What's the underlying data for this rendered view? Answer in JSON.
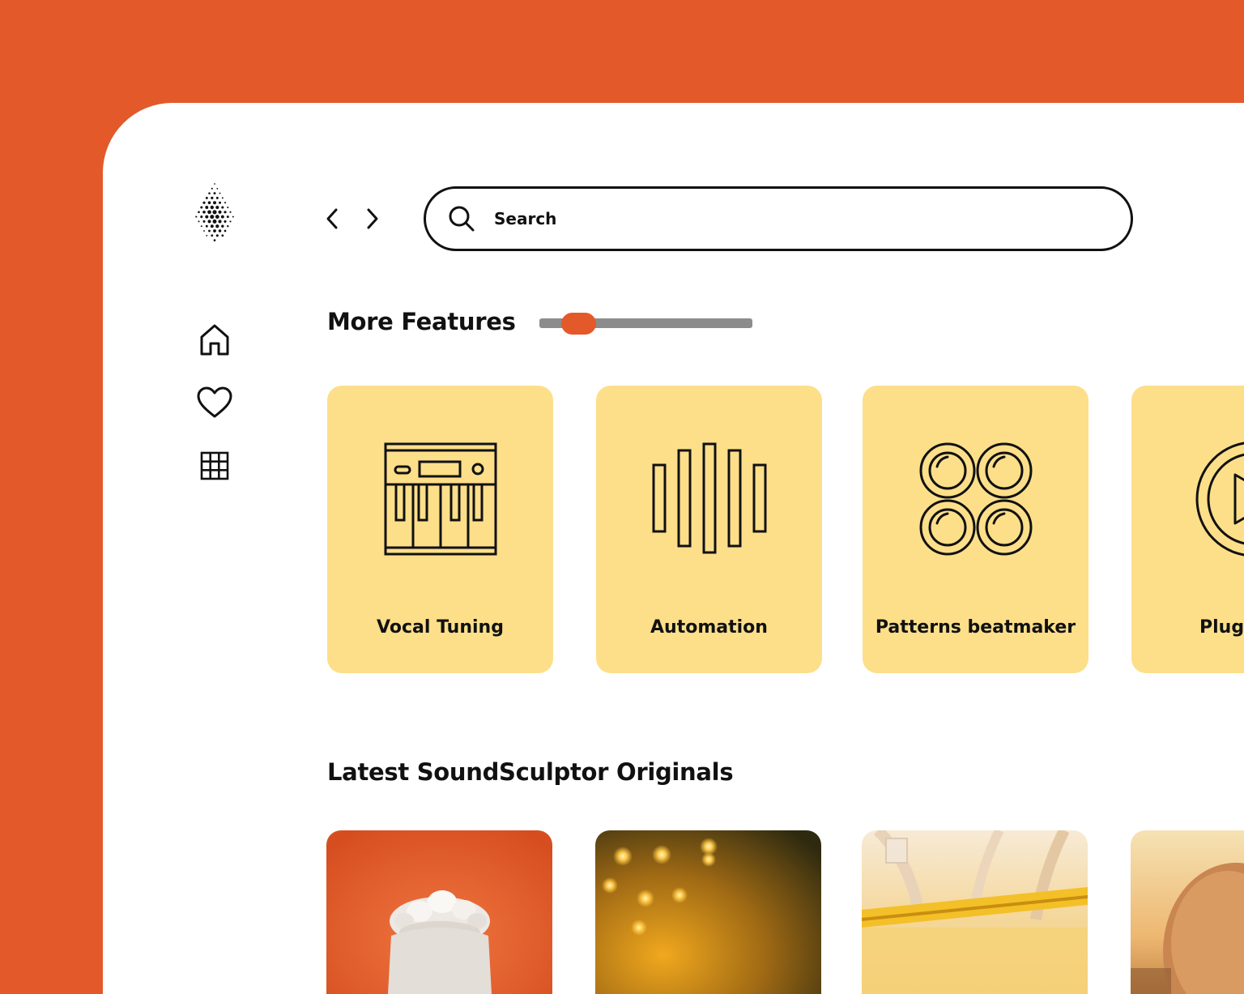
{
  "colors": {
    "accent": "#E4592A",
    "card_bg": "#FDDF8A",
    "slider_track": "#8C8C8C",
    "text": "#111111",
    "background": "#FFFFFF"
  },
  "logo": {
    "icon": "dotted-diamond-logo"
  },
  "sidebar": {
    "items": [
      {
        "icon": "home-icon"
      },
      {
        "icon": "heart-icon"
      },
      {
        "icon": "grid-icon"
      }
    ]
  },
  "nav": {
    "back_icon": "chevron-left-icon",
    "forward_icon": "chevron-right-icon"
  },
  "search": {
    "placeholder": "Search",
    "icon": "search-icon"
  },
  "features": {
    "title": "More Features",
    "carousel_position": 0.1,
    "cards": [
      {
        "label": "Vocal Tuning",
        "icon": "synth-keyboard-icon"
      },
      {
        "label": "Automation",
        "icon": "waveform-bars-icon"
      },
      {
        "label": "Patterns beatmaker",
        "icon": "drum-pads-icon"
      },
      {
        "label": "Plug",
        "icon": "play-circle-icon"
      }
    ]
  },
  "originals": {
    "title": "Latest SoundSculptor Originals",
    "items": [
      {
        "image": "statue-on-orange"
      },
      {
        "image": "warm-lights-night"
      },
      {
        "image": "yellow-blur-hall"
      },
      {
        "image": "sunset-portrait"
      }
    ]
  }
}
